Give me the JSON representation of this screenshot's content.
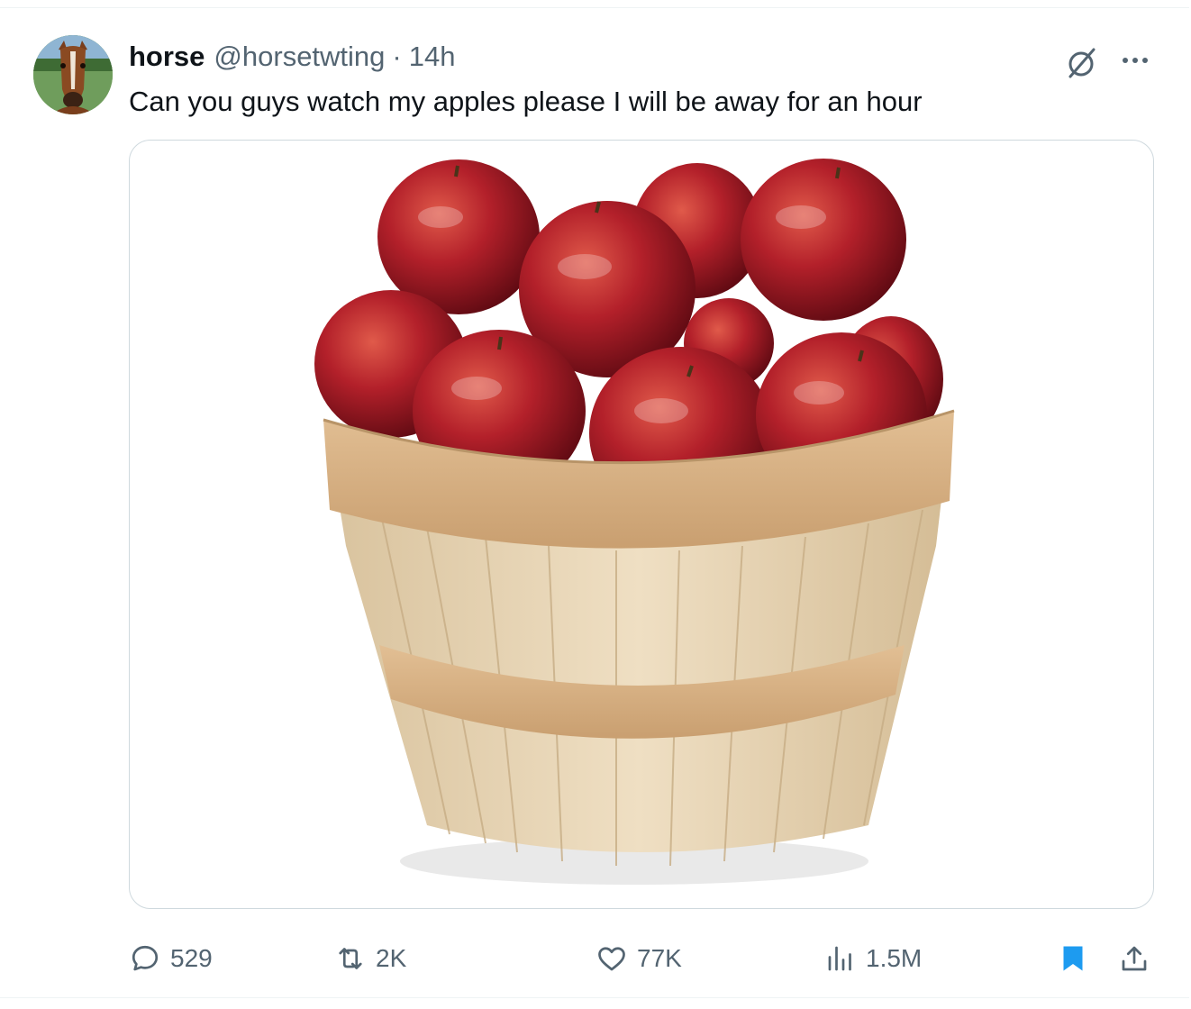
{
  "tweet": {
    "author_name": "horse",
    "handle": "@horsetwting",
    "separator": "·",
    "time": "14h",
    "text": "Can you guys watch my apples please I will be away for an hour",
    "media_alt": "apples in a wooden basket"
  },
  "actions": {
    "replies": "529",
    "reposts": "2K",
    "likes": "77K",
    "views": "1.5M"
  },
  "colors": {
    "text": "#0f1419",
    "secondary": "#536471",
    "bookmark_active": "#1d9bf0",
    "border": "#cfd9de"
  },
  "icons": [
    "grok-icon",
    "more-icon",
    "reply-icon",
    "repost-icon",
    "like-icon",
    "views-icon",
    "bookmark-icon",
    "share-icon"
  ]
}
